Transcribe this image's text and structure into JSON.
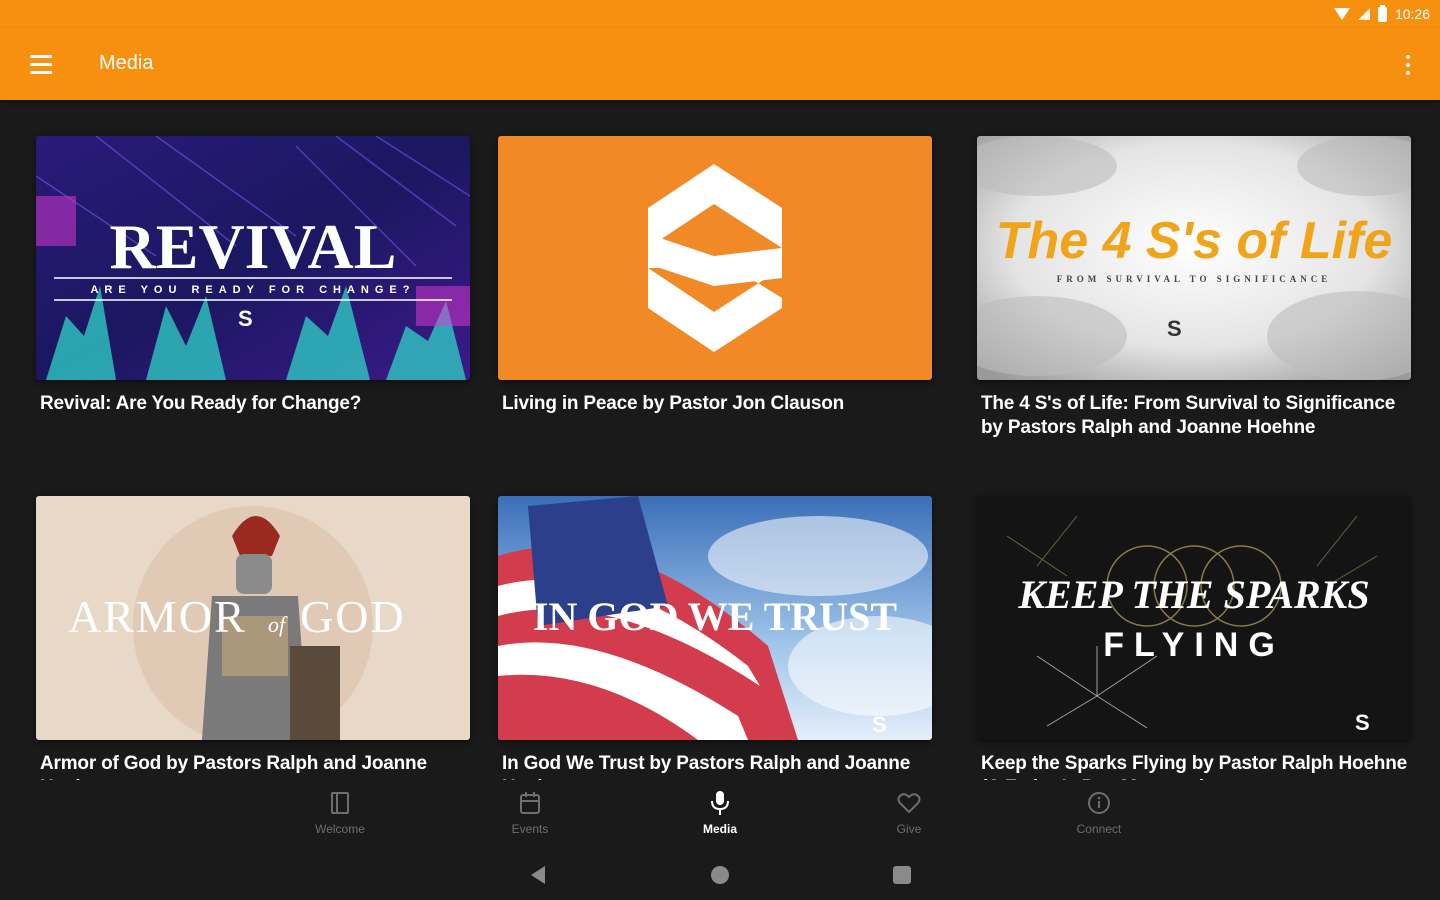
{
  "status_bar": {
    "time": "10:26"
  },
  "app_bar": {
    "title": "Media"
  },
  "colors": {
    "accent": "#f8900f",
    "background": "#1a1a1a",
    "nav_inactive": "#6e6e6e"
  },
  "media": [
    {
      "title": "Revival: Are You Ready for Change?",
      "art": {
        "headline": "REVIVAL",
        "tagline": "ARE YOU READY FOR CHANGE?"
      }
    },
    {
      "title": "Living in Peace by Pastor Jon Clauson",
      "art": {
        "logo": "S"
      }
    },
    {
      "title": "The 4 S's of Life: From Survival to Significance by Pastors Ralph and Joanne Hoehne",
      "art": {
        "headline": "The 4 S's of Life",
        "tagline": "FROM SURVIVAL TO SIGNIFICANCE"
      }
    },
    {
      "title": "Armor of God by Pastors Ralph and Joanne Hoehne",
      "art": {
        "headline_part1": "ARMOR",
        "headline_of": "of",
        "headline_part2": "GOD"
      }
    },
    {
      "title": "In God We Trust by Pastors Ralph and Joanne Hoehne",
      "art": {
        "headline": "IN GOD WE TRUST"
      }
    },
    {
      "title": "Keep the Sparks Flying by Pastor Ralph Hoehne (A Father's Day Message)",
      "art": {
        "headline_line1": "KEEP THE SPARKS",
        "headline_line2": "FLYING"
      }
    }
  ],
  "bottom_nav": [
    {
      "label": "Welcome",
      "icon": "welcome-book-icon"
    },
    {
      "label": "Events",
      "icon": "calendar-icon"
    },
    {
      "label": "Media",
      "icon": "microphone-icon",
      "active": true
    },
    {
      "label": "Give",
      "icon": "heart-icon"
    },
    {
      "label": "Connect",
      "icon": "info-circle-icon"
    }
  ]
}
